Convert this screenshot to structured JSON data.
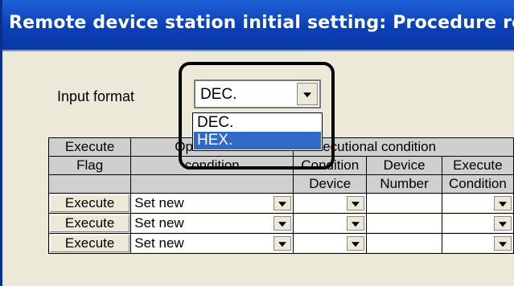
{
  "window": {
    "title": "Remote device station initial setting: Procedure regist"
  },
  "input_format": {
    "label": "Input format",
    "selected": "DEC.",
    "options": [
      "DEC.",
      "HEX."
    ],
    "highlighted_option": "HEX."
  },
  "table": {
    "header": {
      "execute_flag_line1": "Execute",
      "execute_flag_line2": "Flag",
      "operational_line1": "Op",
      "operational_line2": "condition",
      "executional_group": "ecutional condition",
      "condition_device_line1": "Condition",
      "condition_device_line2": "Device",
      "device_number_line1": "Device",
      "device_number_line2": "Number",
      "execute_condition_line1": "Execute",
      "execute_condition_line2": "Condition"
    },
    "rows": [
      {
        "execute": "Execute",
        "operational": "Set new"
      },
      {
        "execute": "Execute",
        "operational": "Set new"
      },
      {
        "execute": "Execute",
        "operational": "Set new"
      }
    ]
  }
}
